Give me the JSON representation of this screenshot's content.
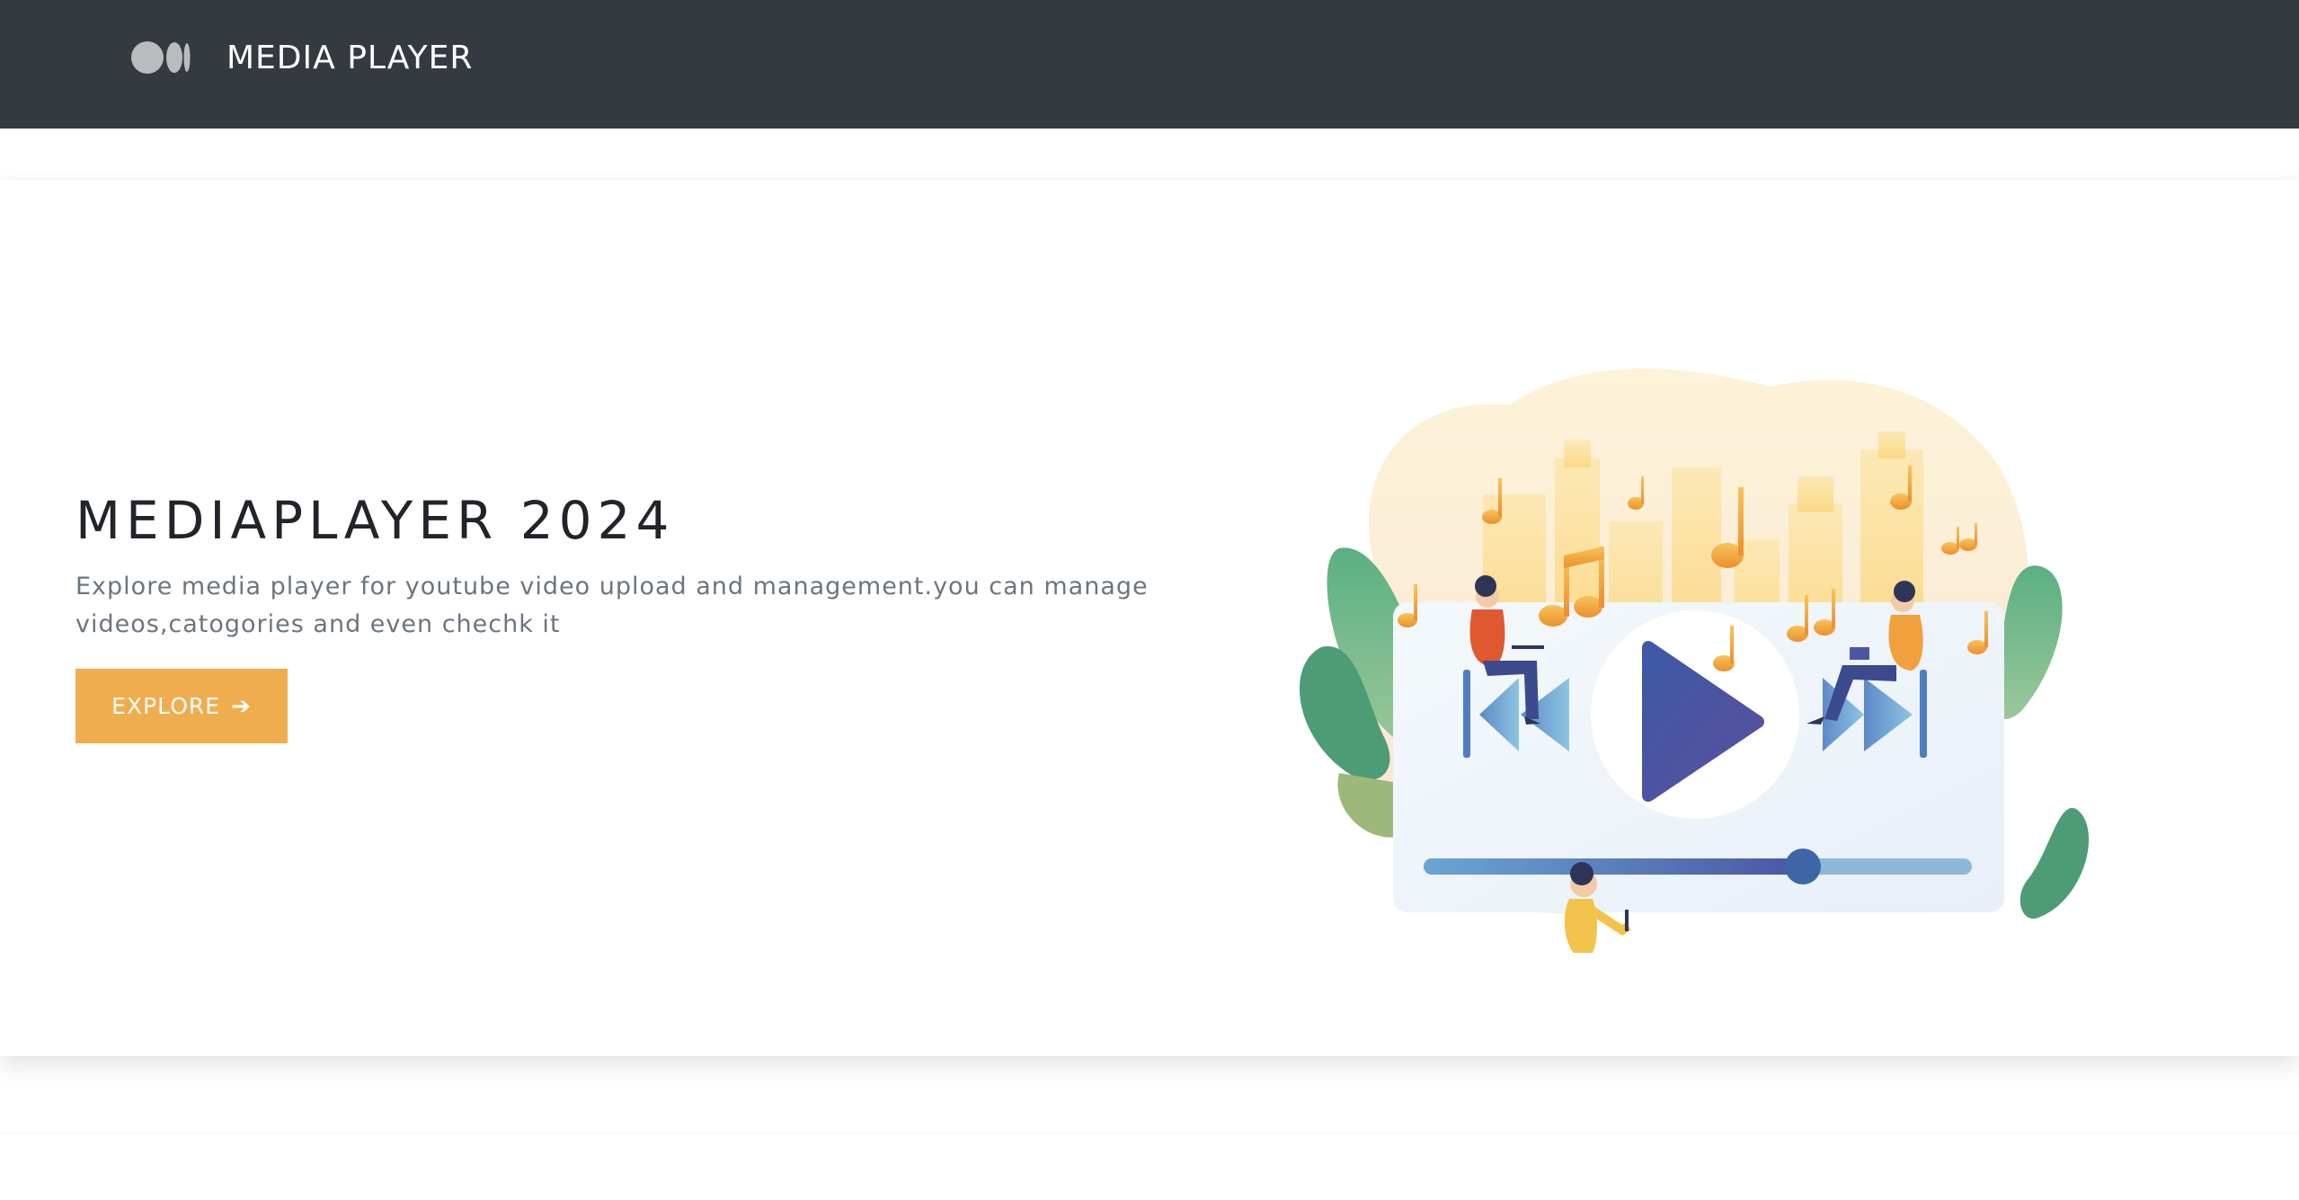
{
  "navbar": {
    "brand_text": "MEDIA PLAYER",
    "logo_icon": "medium-logo-icon",
    "background": "#343a40"
  },
  "hero": {
    "title": "MEDIAPLAYER 2024",
    "description": "Explore media player for youtube video upload and management.you can manage videos,catogories and even chechk it",
    "explore_button": {
      "label": "EXPLORE",
      "icon": "arrow-right-icon",
      "color": "#f0ad4e"
    },
    "illustration": {
      "icons": [
        "previous-icon",
        "play-icon",
        "next-icon",
        "music-note-icon"
      ],
      "playback_progress": 0.69,
      "accent_blue": "#4a56a6",
      "accent_orange": "#f0a63c",
      "leaf_green": "#5aa77e"
    }
  }
}
